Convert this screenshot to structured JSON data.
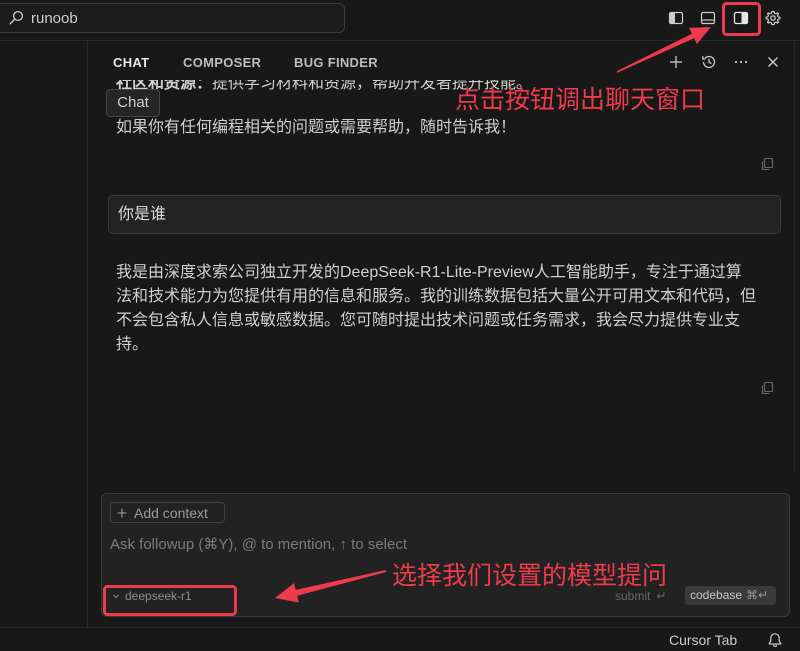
{
  "theme": {
    "background": "#181818",
    "foreground": "#cccccc",
    "border": "#2b2b2b",
    "input_background": "#222222"
  },
  "titlebar": {
    "search": {
      "value": "runoob",
      "icon": "search-icon"
    },
    "layout_controls": [
      {
        "icon": "toggle-primary-sidebar-icon",
        "active": false
      },
      {
        "icon": "toggle-panel-icon",
        "active": false
      },
      {
        "icon": "toggle-secondary-sidebar-icon",
        "active": true
      },
      {
        "icon": "gear-icon",
        "active": false
      }
    ]
  },
  "chat": {
    "tabs": [
      {
        "label": "CHAT",
        "active": true
      },
      {
        "label": "COMPOSER",
        "active": false
      },
      {
        "label": "BUG FINDER",
        "active": false
      }
    ],
    "toolbar_icons": [
      "plus-icon",
      "history-icon",
      "more-icon",
      "close-icon"
    ],
    "tooltip": "Chat",
    "conversation": {
      "previous_reply": {
        "strong": "社区和资源：",
        "text": "提供学习材料和资源，帮助开发者提升技能。",
        "lines": [
          "如果你有任何编程相关的问题或需要帮助，随时告诉我！"
        ],
        "copy_icon": "copy-icon"
      },
      "user_message": {
        "text": "你是谁"
      },
      "reply": {
        "lines": [
          "我是由深度求索公司独立开发的DeepSeek-R1-Lite-Preview人工智能助手，专注于通过算",
          "法和技术能力为您提供有用的信息和服务。我的训练数据包括大量公开可用文本和代码，但",
          "不会包含私人信息或敏感数据。您可随时提出技术问题或任务需求，我会尽力提供专业支",
          "持。"
        ],
        "copy_icon": "copy-icon"
      }
    },
    "input": {
      "add_context": {
        "icon": "plus-icon",
        "label": "Add context"
      },
      "placeholder": "Ask followup (⌘Y), @ to mention, ↑ to select",
      "model_selector": {
        "icon": "chevron-down-icon",
        "value": "deepseek-r1"
      },
      "submit": {
        "label": "submit",
        "shortcut": "↵"
      },
      "codebase": {
        "label": "codebase",
        "shortcut": "⌘↵"
      }
    }
  },
  "statusbar": {
    "cursor_tab": "Cursor Tab",
    "bell_icon": "bell-icon"
  },
  "annotations": {
    "color": "#ee3b4c",
    "callouts": [
      {
        "text": "点击按钮调出聊天窗口"
      },
      {
        "text": "选择我们设置的模型提问"
      }
    ]
  }
}
